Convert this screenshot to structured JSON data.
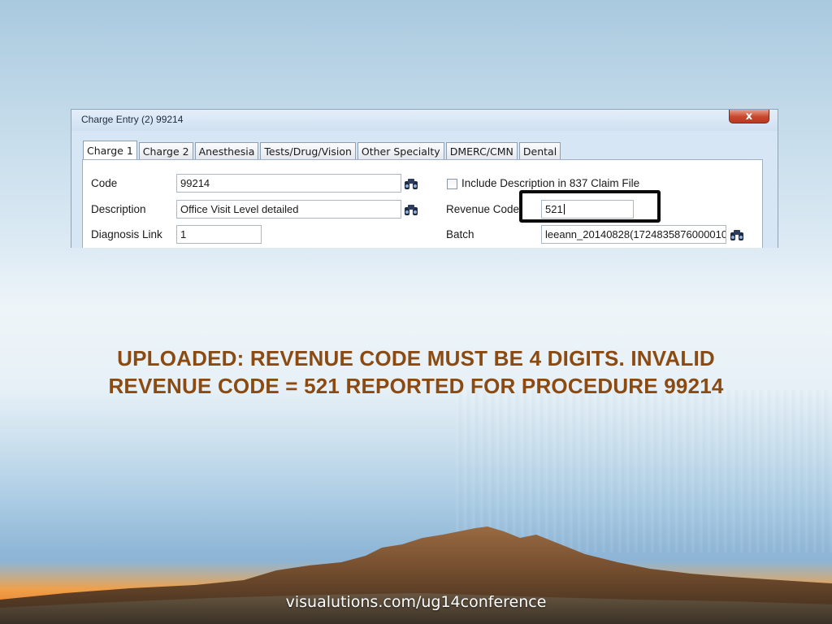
{
  "dialog": {
    "title": "Charge Entry (2) 99214",
    "close_symbol": "x",
    "tabs": [
      {
        "label": "Charge 1",
        "active": true
      },
      {
        "label": "Charge 2",
        "active": false
      },
      {
        "label": "Anesthesia",
        "active": false
      },
      {
        "label": "Tests/Drug/Vision",
        "active": false
      },
      {
        "label": "Other Specialty",
        "active": false
      },
      {
        "label": "DMERC/CMN",
        "active": false
      },
      {
        "label": "Dental",
        "active": false
      }
    ],
    "fields": {
      "code_label": "Code",
      "code_value": "99214",
      "description_label": "Description",
      "description_value": "Office Visit Level detailed",
      "diagnosis_link_label": "Diagnosis Link",
      "diagnosis_link_value": "1",
      "include_description_label": "Include Description in 837 Claim File",
      "include_description_checked": false,
      "revenue_code_label": "Revenue Code",
      "revenue_code_value": "521",
      "batch_label": "Batch",
      "batch_value": "leeann_20140828(1724835876000010"
    },
    "icons": [
      "binoculars-icon",
      "close-icon",
      "checkbox"
    ]
  },
  "slide": {
    "headline_line1": "UPLOADED: REVENUE CODE MUST BE 4 DIGITS.  INVALID",
    "headline_line2": "REVENUE CODE = 521 REPORTED FOR PROCEDURE 99214",
    "footer_url": "visualutions.com/ug14conference"
  },
  "colors": {
    "headline": "#8a4a12",
    "close_button": "#c7462c",
    "highlight_box": "#0a0a0a"
  }
}
